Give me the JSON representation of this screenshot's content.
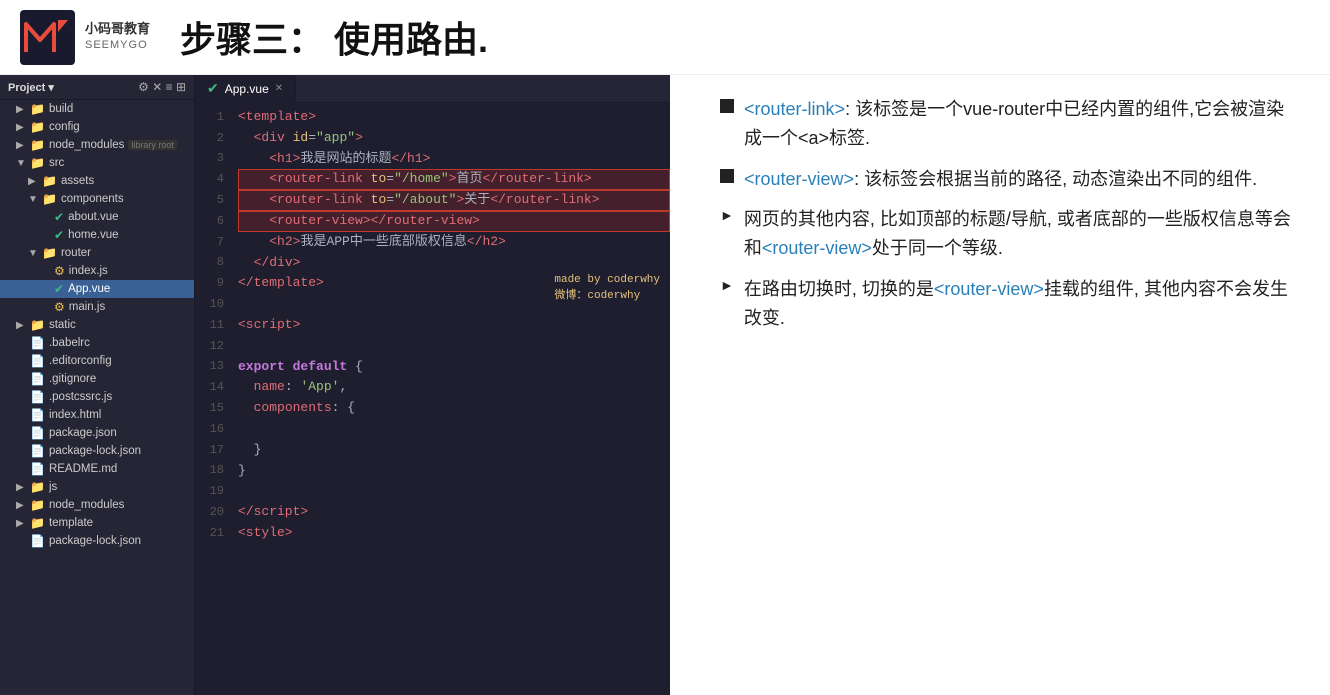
{
  "header": {
    "logo_company": "小码哥教育",
    "logo_brand": "SEEMYGO",
    "title": "步骤三：  使用路由."
  },
  "file_tree": {
    "header_label": "Project",
    "items": [
      {
        "level": 0,
        "type": "folder",
        "arrow": "▶",
        "icon": "📁",
        "label": "build",
        "badge": ""
      },
      {
        "level": 0,
        "type": "folder",
        "arrow": "▶",
        "icon": "📁",
        "label": "config",
        "badge": ""
      },
      {
        "level": 0,
        "type": "folder",
        "arrow": "▶",
        "icon": "📁",
        "label": "node_modules",
        "badge": "library root"
      },
      {
        "level": 0,
        "type": "folder",
        "arrow": "▼",
        "icon": "📁",
        "label": "src",
        "badge": ""
      },
      {
        "level": 1,
        "type": "folder",
        "arrow": "▶",
        "icon": "📁",
        "label": "assets",
        "badge": ""
      },
      {
        "level": 1,
        "type": "folder",
        "arrow": "▼",
        "icon": "📁",
        "label": "components",
        "badge": ""
      },
      {
        "level": 2,
        "type": "file",
        "arrow": "",
        "icon": "✔",
        "label": "about.vue",
        "badge": "",
        "color": "#42b883"
      },
      {
        "level": 2,
        "type": "file",
        "arrow": "",
        "icon": "✔",
        "label": "home.vue",
        "badge": "",
        "color": "#42b883"
      },
      {
        "level": 1,
        "type": "folder",
        "arrow": "▼",
        "icon": "📁",
        "label": "router",
        "badge": ""
      },
      {
        "level": 2,
        "type": "file",
        "arrow": "",
        "icon": "⚙",
        "label": "index.js",
        "badge": ""
      },
      {
        "level": 2,
        "type": "file",
        "arrow": "",
        "icon": "✔",
        "label": "App.vue",
        "badge": "",
        "selected": true,
        "color": "#42b883"
      },
      {
        "level": 2,
        "type": "file",
        "arrow": "",
        "icon": "⚙",
        "label": "main.js",
        "badge": ""
      },
      {
        "level": 0,
        "type": "folder",
        "arrow": "▶",
        "icon": "📁",
        "label": "static",
        "badge": ""
      },
      {
        "level": 0,
        "type": "file",
        "arrow": "",
        "icon": "📄",
        "label": ".babelrc",
        "badge": ""
      },
      {
        "level": 0,
        "type": "file",
        "arrow": "",
        "icon": "📄",
        "label": ".editorconfig",
        "badge": ""
      },
      {
        "level": 0,
        "type": "file",
        "arrow": "",
        "icon": "📄",
        "label": ".gitignore",
        "badge": ""
      },
      {
        "level": 0,
        "type": "file",
        "arrow": "",
        "icon": "📄",
        "label": ".postcssrc.js",
        "badge": ""
      },
      {
        "level": 0,
        "type": "file",
        "arrow": "",
        "icon": "📄",
        "label": "index.html",
        "badge": ""
      },
      {
        "level": 0,
        "type": "file",
        "arrow": "",
        "icon": "📄",
        "label": "package.json",
        "badge": ""
      },
      {
        "level": 0,
        "type": "file",
        "arrow": "",
        "icon": "📄",
        "label": "package-lock.json",
        "badge": ""
      },
      {
        "level": 0,
        "type": "file",
        "arrow": "",
        "icon": "📄",
        "label": "README.md",
        "badge": ""
      },
      {
        "level": 0,
        "type": "folder",
        "arrow": "▶",
        "icon": "📁",
        "label": "js",
        "badge": ""
      },
      {
        "level": 0,
        "type": "folder",
        "arrow": "▶",
        "icon": "📁",
        "label": "node_modules",
        "badge": ""
      },
      {
        "level": 0,
        "type": "folder",
        "arrow": "▶",
        "icon": "📁",
        "label": "template",
        "badge": ""
      },
      {
        "level": 0,
        "type": "file",
        "arrow": "",
        "icon": "📄",
        "label": "package-lock.json",
        "badge": ""
      }
    ]
  },
  "editor": {
    "tab_label": "App.vue",
    "watermark_line1": "made by coderwhy",
    "watermark_line2": "微博：coderwhy"
  },
  "notes": {
    "items": [
      {
        "type": "square",
        "text_parts": [
          {
            "text": "<router-link>",
            "highlight": true
          },
          {
            "text": ": 该标签是一个vue-router中已经内置的组件,它会被渲染成一个<a>标签.",
            "highlight": false
          }
        ]
      },
      {
        "type": "square",
        "text_parts": [
          {
            "text": "<router-view>",
            "highlight": true
          },
          {
            "text": ": 该标签会根据当前的路径, 动态渲染出不同的组件.",
            "highlight": false
          }
        ]
      },
      {
        "type": "triangle",
        "text_parts": [
          {
            "text": "网页的其他内容, 比如顶部的标题/导航, 或者底部的一些版权信息等会和",
            "highlight": false
          },
          {
            "text": "<router-view>",
            "highlight": true
          },
          {
            "text": "处于同一个等级.",
            "highlight": false
          }
        ]
      },
      {
        "type": "triangle",
        "text_parts": [
          {
            "text": "在路由切换时, 切换的是",
            "highlight": false
          },
          {
            "text": "<router-view>",
            "highlight": true
          },
          {
            "text": "挂载的组件, 其他内容不会发生改变.",
            "highlight": false
          }
        ]
      }
    ]
  }
}
